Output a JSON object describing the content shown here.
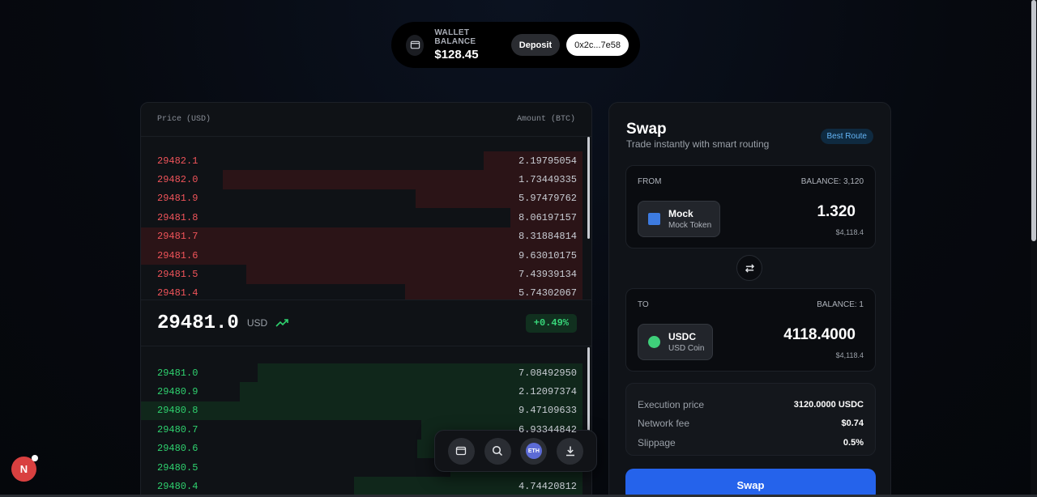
{
  "wallet": {
    "label": "WALLET BALANCE",
    "amount": "$128.45",
    "deposit_label": "Deposit",
    "address": "0x2c...7e58"
  },
  "orderbook": {
    "price_header": "Price (USD)",
    "amount_header": "Amount (BTC)",
    "asks": [
      {
        "price": "29482.1",
        "amount": "2.19795054",
        "depth": 0.224
      },
      {
        "price": "29482.0",
        "amount": "1.73449335",
        "depth": 0.815
      },
      {
        "price": "29481.9",
        "amount": "5.97479762",
        "depth": 0.378
      },
      {
        "price": "29481.8",
        "amount": "8.06197157",
        "depth": 0.163
      },
      {
        "price": "29481.7",
        "amount": "8.31884814",
        "depth": 1.0
      },
      {
        "price": "29481.6",
        "amount": "9.63010175",
        "depth": 1.0
      },
      {
        "price": "29481.5",
        "amount": "7.43939134",
        "depth": 0.762
      },
      {
        "price": "29481.4",
        "amount": "5.74302067",
        "depth": 0.402
      }
    ],
    "mid_price": "29481.0",
    "mid_unit": "USD",
    "change": "+0.49%",
    "bids": [
      {
        "price": "29481.0",
        "amount": "7.08492950",
        "depth": 0.735
      },
      {
        "price": "29480.9",
        "amount": "2.12097374",
        "depth": 0.777
      },
      {
        "price": "29480.8",
        "amount": "9.47109633",
        "depth": 1.0
      },
      {
        "price": "29480.7",
        "amount": "6.93344842",
        "depth": 0.365
      },
      {
        "price": "29480.6",
        "amount": "",
        "depth": 0.374
      },
      {
        "price": "29480.5",
        "amount": "",
        "depth": 0.3
      },
      {
        "price": "29480.4",
        "amount": "4.74420812",
        "depth": 0.517
      }
    ]
  },
  "dock": {
    "items": [
      "wallet-icon",
      "search-icon",
      "eth-icon",
      "download-icon"
    ],
    "eth_label": "ETH"
  },
  "swap": {
    "title": "Swap",
    "subtitle": "Trade instantly with smart routing",
    "route_badge": "Best Route",
    "from": {
      "label": "FROM",
      "balance": "BALANCE: 3,120",
      "symbol": "Mock",
      "name": "Mock Token",
      "value": "1.320",
      "usd": "$4,118.4"
    },
    "to": {
      "label": "TO",
      "balance": "BALANCE: 1",
      "symbol": "USDC",
      "name": "USD Coin",
      "value": "4118.4000",
      "usd": "$4,118.4"
    },
    "details": [
      {
        "key": "Execution price",
        "value": "3120.0000 USDC"
      },
      {
        "key": "Network fee",
        "value": "$0.74"
      },
      {
        "key": "Slippage",
        "value": "0.5%"
      }
    ],
    "button_label": "Swap"
  },
  "next_badge": "N",
  "colors": {
    "ask": "#f0545a",
    "bid": "#2fd26f",
    "accent": "#2563eb"
  }
}
